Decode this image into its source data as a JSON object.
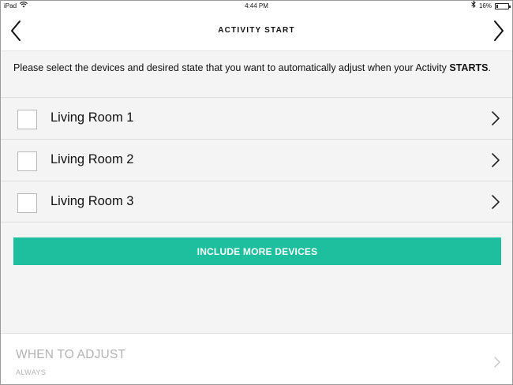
{
  "status_bar": {
    "device": "iPad",
    "time": "4:44 PM",
    "battery": "16%",
    "battery_level": 0.16,
    "icons": [
      "wifi-icon",
      "bluetooth-icon",
      "battery-icon"
    ]
  },
  "nav": {
    "title": "ACTIVITY START",
    "back_icon": "chevron-left-icon",
    "forward_icon": "chevron-right-icon"
  },
  "instructions": {
    "text": "Please select the devices and desired state that you want to automatically adjust when your Activity ",
    "emphasis": "STARTS",
    "suffix": "."
  },
  "devices": [
    {
      "label": "Living Room 1",
      "checked": false
    },
    {
      "label": "Living Room 2",
      "checked": false
    },
    {
      "label": "Living Room 3",
      "checked": false
    }
  ],
  "include_button": {
    "label": "INCLUDE MORE DEVICES"
  },
  "when_to_adjust": {
    "title": "WHEN TO ADJUST",
    "value": "ALWAYS"
  },
  "colors": {
    "accent": "#1dbf9f",
    "background": "#f4f4f4",
    "disabled_text": "#b3b3b3"
  }
}
